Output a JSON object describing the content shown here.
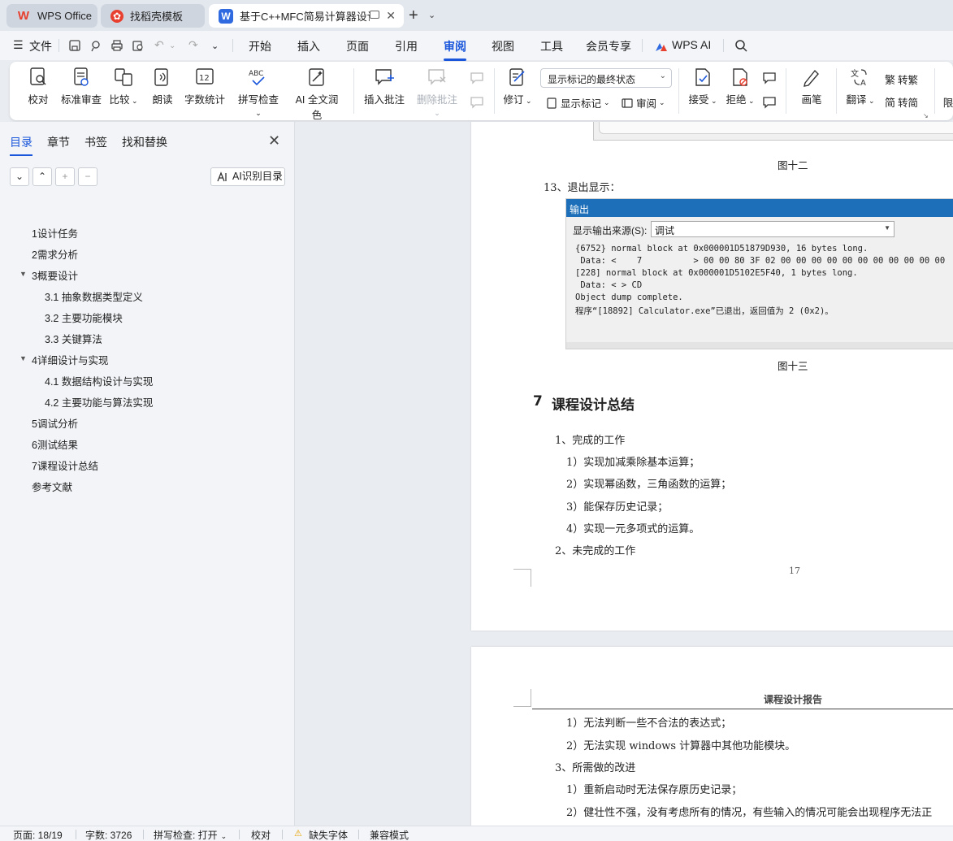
{
  "tabs": [
    {
      "label": "WPS Office"
    },
    {
      "label": "找稻壳模板"
    },
    {
      "label": "基于C++MFC简易计算器设计"
    }
  ],
  "menu": {
    "file": "文件",
    "items": [
      "开始",
      "插入",
      "页面",
      "引用",
      "审阅",
      "视图",
      "工具",
      "会员专享"
    ],
    "active": "审阅",
    "wps_ai": "WPS AI"
  },
  "ribbon": {
    "proofread": "校对",
    "standard_review": "标准审查",
    "compare": "比较",
    "read_aloud": "朗读",
    "word_count": "字数统计",
    "spell_check": "拼写检查",
    "ai_polish": "AI 全文润色",
    "insert_comment": "插入批注",
    "delete_comment": "删除批注",
    "revise": "修订",
    "markup_combo": "显示标记的最终状态",
    "show_markup": "显示标记",
    "review_pane": "审阅",
    "accept": "接受",
    "reject": "拒绝",
    "pen": "画笔",
    "translate": "翻译",
    "to_traditional": "转繁",
    "to_simplified": "转简",
    "limit": "限"
  },
  "sidebar": {
    "tabs": [
      "目录",
      "章节",
      "书签",
      "找和替换"
    ],
    "active_tab": "目录",
    "ai_toc": "AI识别目录",
    "toc": [
      {
        "label": "1设计任务",
        "level": 1
      },
      {
        "label": "2需求分析",
        "level": 1
      },
      {
        "label": "3概要设计",
        "level": 1,
        "expanded": true
      },
      {
        "label": "3.1 抽象数据类型定义",
        "level": 2
      },
      {
        "label": "3.2  主要功能模块",
        "level": 2
      },
      {
        "label": "3.3  关键算法",
        "level": 2
      },
      {
        "label": "4详细设计与实现",
        "level": 1,
        "expanded": true
      },
      {
        "label": "4.1  数据结构设计与实现",
        "level": 2
      },
      {
        "label": "4.2  主要功能与算法实现",
        "level": 2
      },
      {
        "label": "5调试分析",
        "level": 1
      },
      {
        "label": "6测试结果",
        "level": 1
      },
      {
        "label": "7课程设计总结",
        "level": 1
      },
      {
        "label": "参考文献",
        "level": 1
      }
    ]
  },
  "document": {
    "fig12_caption": "图十二",
    "item13": "13、退出显示：",
    "output_window": {
      "title": "输出",
      "source_label": "显示输出来源(S):",
      "source_value": "调试",
      "lines": [
        "{6752} normal block at 0x000001D51879D930, 16 bytes long.",
        " Data: <    7          > 00 00 80 3F 02 00 00 00 00 00 00 00 00 00 00 00",
        "[228] normal block at 0x000001D5102E5F40, 1 bytes long.",
        " Data: < > CD",
        "Object dump complete.",
        "程序“[18892] Calculator.exe”已退出，返回值为 2 (0x2)。"
      ]
    },
    "fig13_caption": "图十三",
    "section_num": "7",
    "section_title": "课程设计总结",
    "p1": "1、完成的工作",
    "p1_items": [
      "1）实现加减乘除基本运算；",
      "2）实现幂函数，三角函数的运算；",
      "3）能保存历史记录；",
      "4）实现一元多项式的运算。"
    ],
    "p2": "2、未完成的工作",
    "page_number": "17",
    "page2_header": "课程设计报告",
    "p2_items": [
      "1）无法判断一些不合法的表达式；",
      "2）无法实现 windows 计算器中其他功能模块。"
    ],
    "p3": "3、所需做的改进",
    "p3_items": [
      "1）重新启动时无法保存原历史记录；",
      "2）健壮性不强，没有考虑所有的情况，有些输入的情况可能会出现程序无法正"
    ]
  },
  "status": {
    "page": "页面: 18/19",
    "words": "字数: 3726",
    "spell": "拼写检查: 打开",
    "proof": "校对",
    "missing_font": "缺失字体",
    "compat": "兼容模式"
  },
  "colors": {
    "accent": "#1a56db",
    "wps_red": "#e8402f",
    "output_title": "#1c6fb8"
  }
}
